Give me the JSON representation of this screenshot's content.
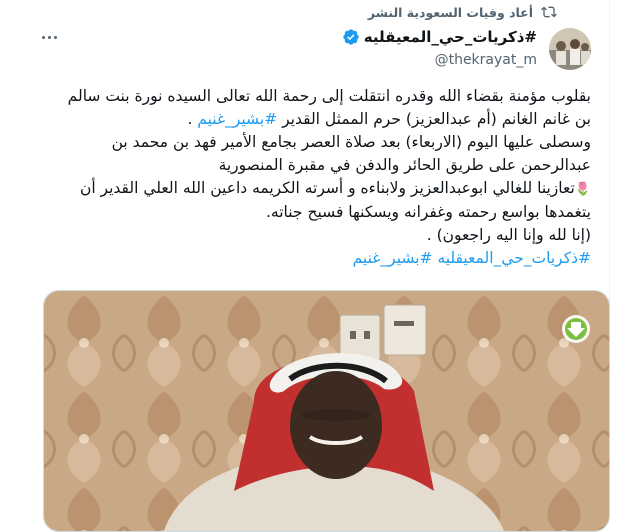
{
  "retweet": {
    "label": "أعاد وفيات السعودية النشر",
    "icon": "retweet-icon"
  },
  "author": {
    "name": "#ذكريات_حي_المعيقليه",
    "handle": "@thekrayat_m",
    "verified_icon": "verified-badge-icon",
    "avatar": "avatar"
  },
  "tweet": {
    "para1_line1": "بقلوب مؤمنة بقضاء الله وقدره انتقلت إلى رحمة الله تعالى السيده  نورة بنت سالم",
    "para1_line2_text": "بن غانم الغانم (أم عبدالعزيز) حرم الممثل القدير ",
    "para1_line2_link": "#بشير_غنيم",
    "para1_line2_end": " .",
    "para2_line1": "وسصلى عليها اليوم (الاربعاء) بعد صلاة العصر بجامع الأمير فهد بن محمد  بن",
    "para2_line2": "عبدالرحمن على طريق الحائر والدفن في مقبرة المنصورية",
    "para3_line1_text": "تعازينا للغالي ابوعبدالعزيز ولابناءه و أسرته الكريمه داعين الله العلي القدير أن",
    "para3_emoji": "🌷",
    "para3_line2": "يتغمدها بواسع رحمته وغفرانه ويسكنها فسيح جناته.",
    "para4": "(إنا لله وإنا اليه راجعون) .",
    "hashtag1": "#ذكريات_حي_المعيقليه",
    "hashtag2": "#بشير_غنيم"
  },
  "colors": {
    "link": "#1d9bf0",
    "muted": "#536471",
    "text": "#0f1419",
    "verified": "#1d9bf0"
  }
}
